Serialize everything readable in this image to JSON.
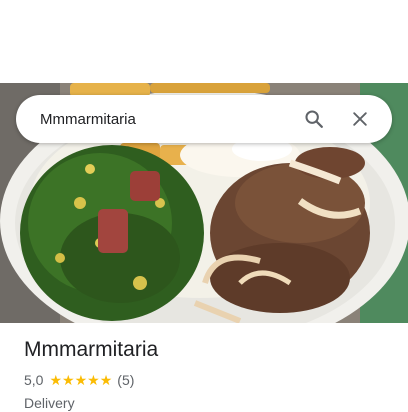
{
  "search": {
    "query": "Mmmarmitaria"
  },
  "place": {
    "name": "Mmmarmitaria",
    "rating": "5,0",
    "star_count": 5,
    "reviews": "(5)",
    "category": "Delivery"
  },
  "icons": {
    "search": "search-icon",
    "close": "close-icon",
    "star": "star-icon"
  },
  "colors": {
    "star": "#fbbc04",
    "text_primary": "#202124",
    "text_secondary": "#5f6368"
  }
}
